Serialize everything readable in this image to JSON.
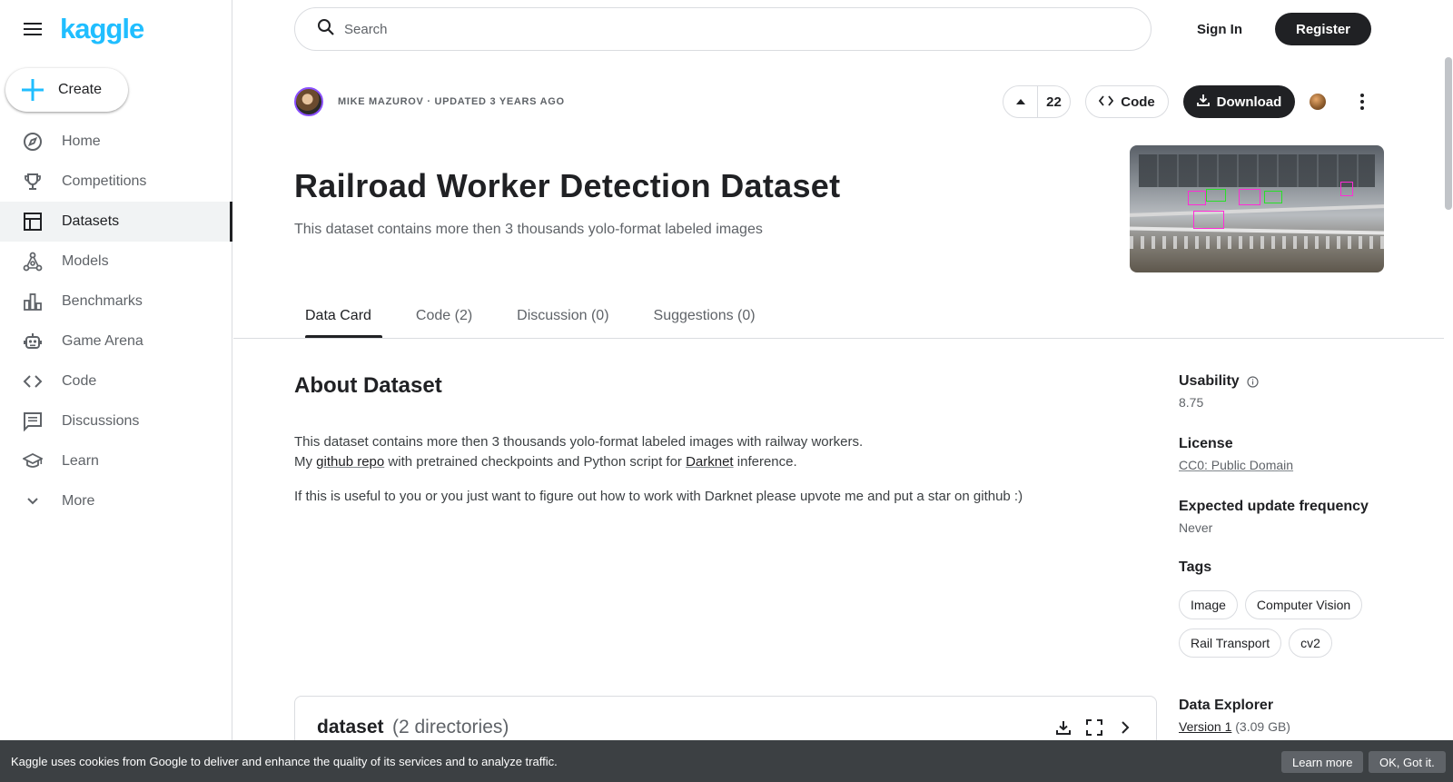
{
  "brand": {
    "logo": "kaggle"
  },
  "sidebar": {
    "create_label": "Create",
    "items": [
      {
        "label": "Home",
        "icon": "compass-icon"
      },
      {
        "label": "Competitions",
        "icon": "trophy-icon"
      },
      {
        "label": "Datasets",
        "icon": "table-icon",
        "active": true
      },
      {
        "label": "Models",
        "icon": "models-icon"
      },
      {
        "label": "Benchmarks",
        "icon": "bar-chart-icon"
      },
      {
        "label": "Game Arena",
        "icon": "robot-icon"
      },
      {
        "label": "Code",
        "icon": "code-icon"
      },
      {
        "label": "Discussions",
        "icon": "comment-icon"
      },
      {
        "label": "Learn",
        "icon": "school-icon"
      },
      {
        "label": "More",
        "icon": "chevron-down-icon"
      }
    ]
  },
  "header": {
    "search_placeholder": "Search",
    "sign_in": "Sign In",
    "register": "Register"
  },
  "dataset": {
    "author_line": "MIKE MAZUROV · UPDATED 3 YEARS AGO",
    "votes": "22",
    "code_label": "Code",
    "download_label": "Download",
    "title": "Railroad Worker Detection Dataset",
    "subtitle": "This dataset contains more then 3 thousands yolo-format labeled images"
  },
  "tabs": [
    {
      "label": "Data Card",
      "active": true
    },
    {
      "label": "Code (2)"
    },
    {
      "label": "Discussion (0)"
    },
    {
      "label": "Suggestions (0)"
    }
  ],
  "about": {
    "heading": "About Dataset",
    "line1": "This dataset contains more then 3 thousands yolo-format labeled images with railway workers.",
    "line2_pre": "My ",
    "line2_link1": "github repo",
    "line2_mid": " with pretrained checkpoints and Python script for ",
    "line2_link2": "Darknet",
    "line2_post": " inference.",
    "line3": "If this is useful to you or you just want to figure out how to work with Darknet please upvote me and put a star on github :)"
  },
  "files": {
    "title": "dataset",
    "count": "(2 directories)"
  },
  "meta": {
    "usability_label": "Usability",
    "usability_value": "8.75",
    "license_label": "License",
    "license_value": "CC0: Public Domain",
    "frequency_label": "Expected update frequency",
    "frequency_value": "Never",
    "tags_label": "Tags",
    "tags": [
      "Image",
      "Computer Vision",
      "Rail Transport",
      "cv2"
    ],
    "explorer_label": "Data Explorer",
    "explorer_version": "Version 1",
    "explorer_size": " (3.09 GB)"
  },
  "cookie": {
    "text": "Kaggle uses cookies from Google to deliver and enhance the quality of its services and to analyze traffic.",
    "learn_more": "Learn more",
    "ok": "OK, Got it."
  },
  "colors": {
    "brand": "#20beff",
    "dark": "#202124",
    "muted": "#5f6368",
    "border": "#dadce0"
  }
}
